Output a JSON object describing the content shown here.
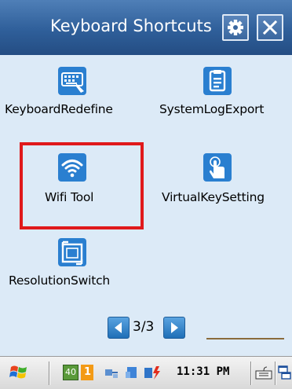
{
  "window": {
    "title": "Keyboard Shortcuts",
    "settings_icon": "gear-icon",
    "close_icon": "close-icon"
  },
  "items": [
    {
      "label": "KeyboardRedefine",
      "icon": "keyboard-redefine-icon"
    },
    {
      "label": "SystemLogExport",
      "icon": "clipboard-icon"
    },
    {
      "label": "Wifi Tool",
      "icon": "wifi-icon"
    },
    {
      "label": "VirtualKeySetting",
      "icon": "touch-hand-icon"
    },
    {
      "label": "ResolutionSwitch",
      "icon": "resolution-switch-icon"
    }
  ],
  "pager": {
    "text": "3/3",
    "prev_icon": "arrow-left-icon",
    "next_icon": "arrow-right-icon"
  },
  "taskbar": {
    "clock": "11:31 PM",
    "signal_badge": "40",
    "notification_badge": "1",
    "start_icon": "windows-flag-icon",
    "input_icon": "keyboard-icon",
    "switch_icon": "window-switch-icon"
  },
  "colors": {
    "titlebar": "#2f5f9a",
    "content_background": "#dceaf7",
    "highlight_border": "#e0191b",
    "icon_blue": "#2a7fd0"
  }
}
